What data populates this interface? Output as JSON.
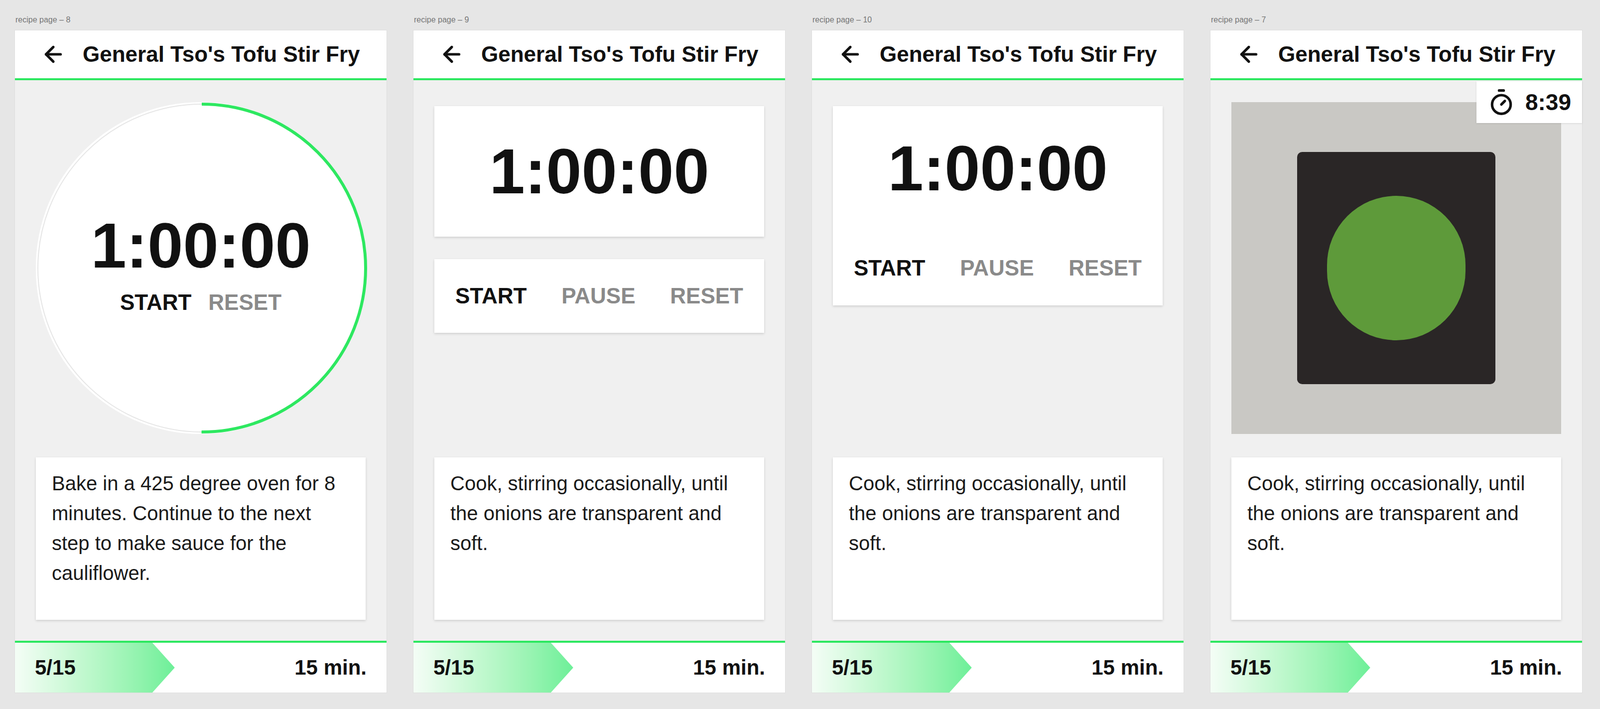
{
  "frames": [
    {
      "label": "recipe page – 8",
      "kind": "circle",
      "title": "General Tso's Tofu Stir Fry",
      "timer": {
        "time": "1:00:00",
        "level": 0.5,
        "controls": [
          {
            "label": "START",
            "enabled": true
          },
          {
            "label": "RESET",
            "enabled": false
          }
        ]
      },
      "step": "Bake in a 425 degree oven for 8 minutes. Continue to the next step to make sauce for the cauliflower.",
      "progress": {
        "label": "5/15",
        "level": 0.43
      },
      "duration": "15 min."
    },
    {
      "label": "recipe page – 9",
      "kind": "split",
      "title": "General Tso's Tofu Stir Fry",
      "timer": {
        "time": "1:00:00",
        "controls": [
          {
            "label": "START",
            "enabled": true
          },
          {
            "label": "PAUSE",
            "enabled": false
          },
          {
            "label": "RESET",
            "enabled": false
          }
        ]
      },
      "step": "Cook, stirring occasionally, until the onions are transparent and soft.",
      "progress": {
        "label": "5/15",
        "level": 0.43
      },
      "duration": "15 min."
    },
    {
      "label": "recipe page – 10",
      "kind": "joined",
      "title": "General Tso's Tofu Stir Fry",
      "timer": {
        "time": "1:00:00",
        "controls": [
          {
            "label": "START",
            "enabled": true
          },
          {
            "label": "PAUSE",
            "enabled": false
          },
          {
            "label": "RESET",
            "enabled": false
          }
        ]
      },
      "step": "Cook, stirring occasionally, until the onions are transparent and soft.",
      "progress": {
        "label": "5/15",
        "level": 0.43
      },
      "duration": "15 min."
    },
    {
      "label": "recipe page – 7",
      "kind": "photo",
      "title": "General Tso's Tofu Stir Fry",
      "badge": "8:39",
      "step": "Cook, stirring occasionally, until the onions are transparent and soft.",
      "progress": {
        "label": "5/15",
        "level": 0.43
      },
      "duration": "15 min."
    }
  ]
}
